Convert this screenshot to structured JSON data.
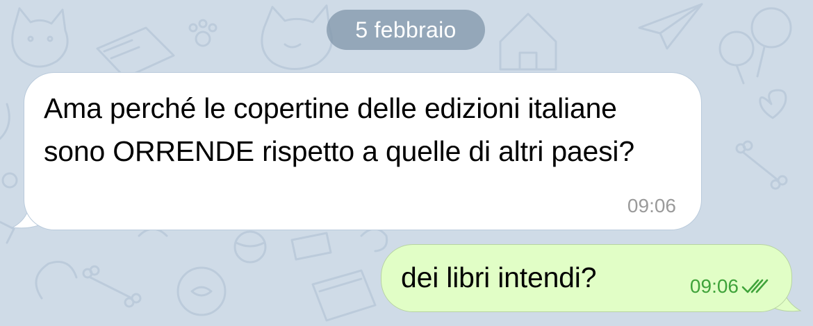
{
  "chat": {
    "date_separator": "5 febbraio",
    "messages": [
      {
        "direction": "incoming",
        "text": "Ama perché le copertine delle edizioni italiane sono ORRENDE rispetto a quelle di altri paesi?",
        "time": "09:06"
      },
      {
        "direction": "outgoing",
        "text": "dei libri intendi?",
        "time": "09:06",
        "status_icon": "double-check-read-icon"
      }
    ]
  },
  "colors": {
    "wallpaper": "#cfdbe7",
    "incoming_bubble": "#ffffff",
    "outgoing_bubble": "#e1fec6",
    "outgoing_meta": "#3fa33a",
    "date_pill": "#8096aa"
  }
}
